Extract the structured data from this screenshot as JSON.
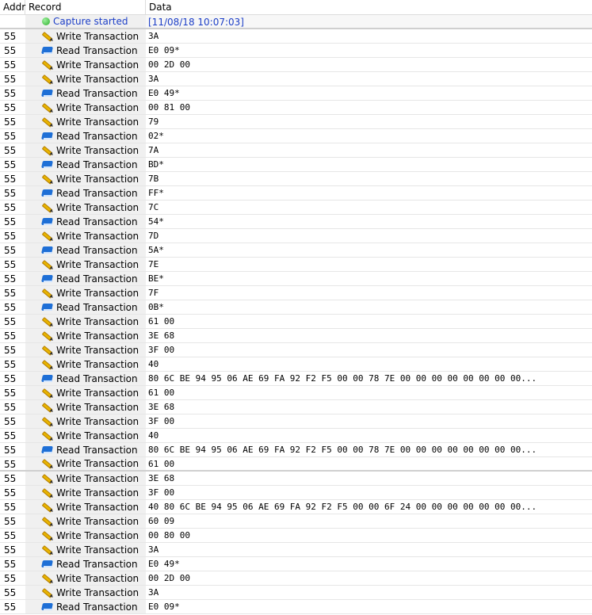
{
  "columns": {
    "addr": "Addr",
    "record": "Record",
    "data": "Data"
  },
  "capture": {
    "label": "Capture started",
    "time": "[11/08/18 10:07:03]",
    "icon": "green-dot-icon"
  },
  "rows": [
    {
      "addr": "55",
      "type": "write",
      "record": "Write Transaction",
      "data": "3A"
    },
    {
      "addr": "55",
      "type": "read",
      "record": "Read Transaction",
      "data": "E0 09*"
    },
    {
      "addr": "55",
      "type": "write",
      "record": "Write Transaction",
      "data": "00 2D 00"
    },
    {
      "addr": "55",
      "type": "write",
      "record": "Write Transaction",
      "data": "3A"
    },
    {
      "addr": "55",
      "type": "read",
      "record": "Read Transaction",
      "data": "E0 49*"
    },
    {
      "addr": "55",
      "type": "write",
      "record": "Write Transaction",
      "data": "00 81 00"
    },
    {
      "addr": "55",
      "type": "write",
      "record": "Write Transaction",
      "data": "79"
    },
    {
      "addr": "55",
      "type": "read",
      "record": "Read Transaction",
      "data": "02*"
    },
    {
      "addr": "55",
      "type": "write",
      "record": "Write Transaction",
      "data": "7A"
    },
    {
      "addr": "55",
      "type": "read",
      "record": "Read Transaction",
      "data": "BD*"
    },
    {
      "addr": "55",
      "type": "write",
      "record": "Write Transaction",
      "data": "7B"
    },
    {
      "addr": "55",
      "type": "read",
      "record": "Read Transaction",
      "data": "FF*"
    },
    {
      "addr": "55",
      "type": "write",
      "record": "Write Transaction",
      "data": "7C"
    },
    {
      "addr": "55",
      "type": "read",
      "record": "Read Transaction",
      "data": "54*"
    },
    {
      "addr": "55",
      "type": "write",
      "record": "Write Transaction",
      "data": "7D"
    },
    {
      "addr": "55",
      "type": "read",
      "record": "Read Transaction",
      "data": "5A*"
    },
    {
      "addr": "55",
      "type": "write",
      "record": "Write Transaction",
      "data": "7E"
    },
    {
      "addr": "55",
      "type": "read",
      "record": "Read Transaction",
      "data": "BE*"
    },
    {
      "addr": "55",
      "type": "write",
      "record": "Write Transaction",
      "data": "7F"
    },
    {
      "addr": "55",
      "type": "read",
      "record": "Read Transaction",
      "data": "0B*"
    },
    {
      "addr": "55",
      "type": "write",
      "record": "Write Transaction",
      "data": "61 00"
    },
    {
      "addr": "55",
      "type": "write",
      "record": "Write Transaction",
      "data": "3E 68"
    },
    {
      "addr": "55",
      "type": "write",
      "record": "Write Transaction",
      "data": "3F 00"
    },
    {
      "addr": "55",
      "type": "write",
      "record": "Write Transaction",
      "data": "40"
    },
    {
      "addr": "55",
      "type": "read",
      "record": "Read Transaction",
      "data": "80 6C BE 94 95 06 AE 69 FA 92 F2 F5 00 00 78 7E 00 00 00 00 00 00 00 00..."
    },
    {
      "addr": "55",
      "type": "write",
      "record": "Write Transaction",
      "data": "61 00"
    },
    {
      "addr": "55",
      "type": "write",
      "record": "Write Transaction",
      "data": "3E 68"
    },
    {
      "addr": "55",
      "type": "write",
      "record": "Write Transaction",
      "data": "3F 00"
    },
    {
      "addr": "55",
      "type": "write",
      "record": "Write Transaction",
      "data": "40"
    },
    {
      "addr": "55",
      "type": "read",
      "record": "Read Transaction",
      "data": "80 6C BE 94 95 06 AE 69 FA 92 F2 F5 00 00 78 7E 00 00 00 00 00 00 00 00..."
    },
    {
      "addr": "55",
      "type": "write",
      "record": "Write Transaction",
      "data": "61 00",
      "sep": true
    },
    {
      "addr": "55",
      "type": "write",
      "record": "Write Transaction",
      "data": "3E 68"
    },
    {
      "addr": "55",
      "type": "write",
      "record": "Write Transaction",
      "data": "3F 00"
    },
    {
      "addr": "55",
      "type": "write",
      "record": "Write Transaction",
      "data": "40 80 6C BE 94 95 06 AE 69 FA 92 F2 F5 00 00 6F 24 00 00 00 00 00 00 00..."
    },
    {
      "addr": "55",
      "type": "write",
      "record": "Write Transaction",
      "data": "60 09"
    },
    {
      "addr": "55",
      "type": "write",
      "record": "Write Transaction",
      "data": "00 80 00"
    },
    {
      "addr": "55",
      "type": "write",
      "record": "Write Transaction",
      "data": "3A"
    },
    {
      "addr": "55",
      "type": "read",
      "record": "Read Transaction",
      "data": "E0 49*"
    },
    {
      "addr": "55",
      "type": "write",
      "record": "Write Transaction",
      "data": "00 2D 00"
    },
    {
      "addr": "55",
      "type": "write",
      "record": "Write Transaction",
      "data": "3A"
    },
    {
      "addr": "55",
      "type": "read",
      "record": "Read Transaction",
      "data": "E0 09*"
    }
  ]
}
